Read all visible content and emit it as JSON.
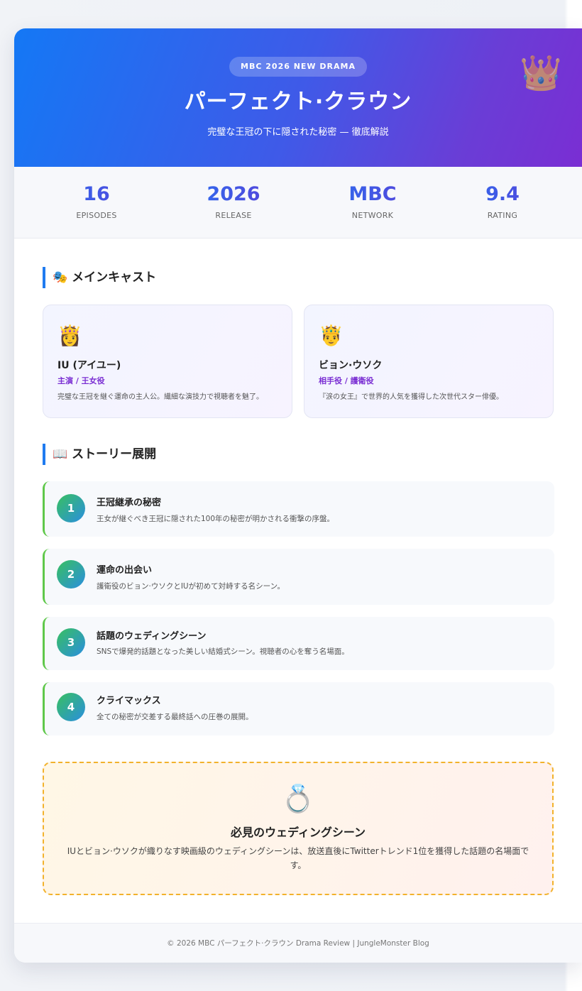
{
  "hero": {
    "badge": "MBC 2026 NEW DRAMA",
    "title": "パーフェクト·クラウン",
    "subtitle": "完璧な王冠の下に隠された秘密 — 徹底解説",
    "crown_icon": "👑"
  },
  "stats": [
    {
      "value": "16",
      "label": "EPISODES"
    },
    {
      "value": "2026",
      "label": "RELEASE"
    },
    {
      "value": "MBC",
      "label": "NETWORK"
    },
    {
      "value": "9.4",
      "label": "RATING"
    }
  ],
  "cast_section": {
    "icon": "🎭",
    "title": "メインキャスト",
    "members": [
      {
        "emoji": "👸",
        "name": "IU (アイユー)",
        "role": "主演 / 王女役",
        "desc": "完璧な王冠を継ぐ運命の主人公。繊細な演技力で視聴者を魅了。"
      },
      {
        "emoji": "🤴",
        "name": "ビョン·ウソク",
        "role": "相手役 / 護衛役",
        "desc": "『涙の女王』で世界的人気を獲得した次世代スター俳優。"
      }
    ]
  },
  "story_section": {
    "icon": "📖",
    "title": "ストーリー展開",
    "steps": [
      {
        "num": "1",
        "title": "王冠継承の秘密",
        "desc": "王女が継ぐべき王冠に隠された100年の秘密が明かされる衝撃の序盤。"
      },
      {
        "num": "2",
        "title": "運命の出会い",
        "desc": "護衛役のビョン·ウソクとIUが初めて対峙する名シーン。"
      },
      {
        "num": "3",
        "title": "話題のウェディングシーン",
        "desc": "SNSで爆発的話題となった美しい結婚式シーン。視聴者の心を奪う名場面。"
      },
      {
        "num": "4",
        "title": "クライマックス",
        "desc": "全ての秘密が交差する最終話への圧巻の展開。"
      }
    ]
  },
  "highlight": {
    "icon": "💍",
    "title": "必見のウェディングシーン",
    "desc": "IUとビョン·ウソクが織りなす映画級のウェディングシーンは、放送直後にTwitterトレンド1位を獲得した話題の名場面です。"
  },
  "footer": {
    "text": "© 2026 MBC パーフェクト·クラウン Drama Review | JungleMonster Blog"
  }
}
